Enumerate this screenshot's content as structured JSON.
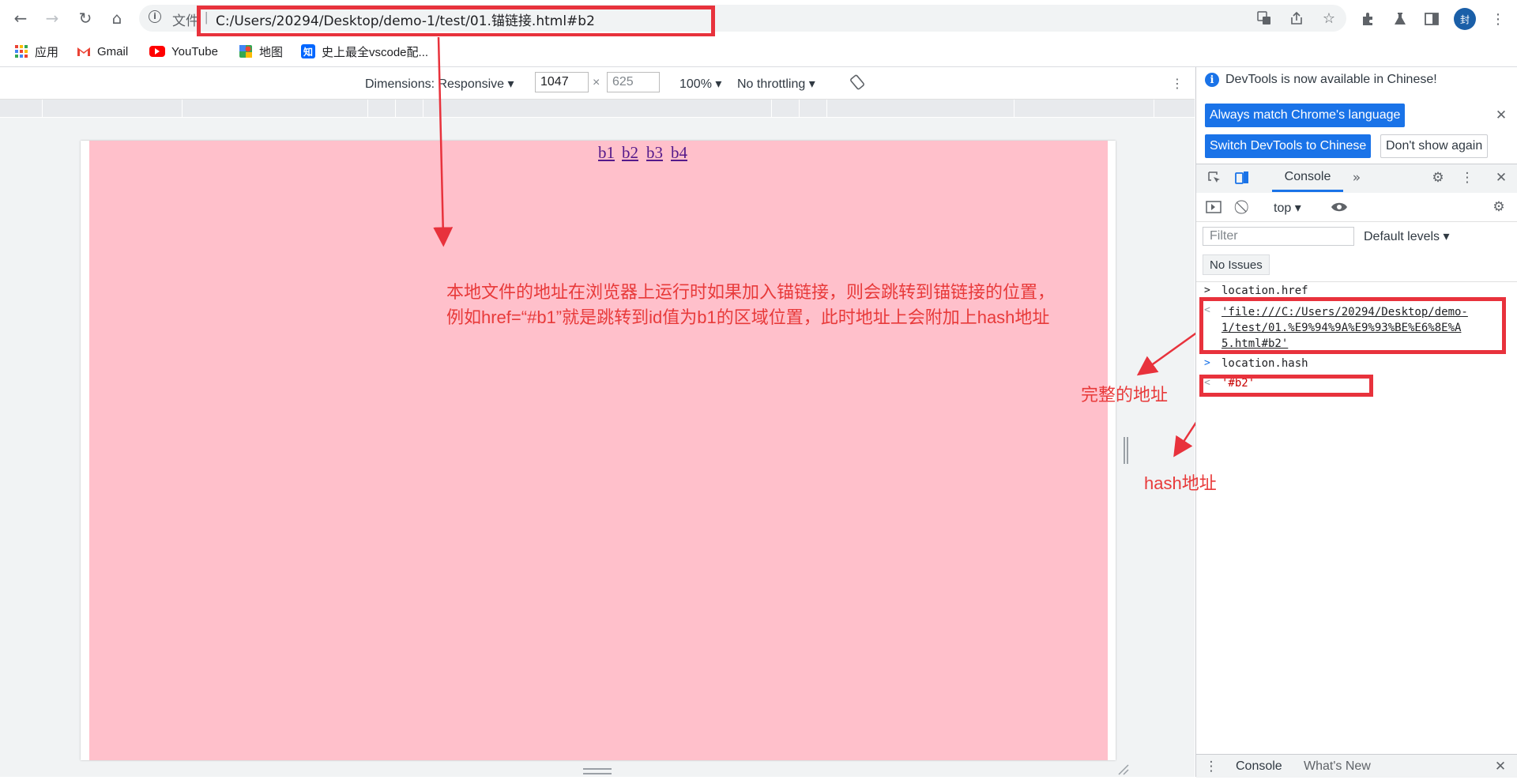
{
  "browser": {
    "nav": {
      "back": "←",
      "forward": "→",
      "reload": "↻",
      "home": "⌂"
    },
    "omnibox": {
      "security_label": "文件",
      "separator": "|",
      "url": "C:/Users/20294/Desktop/demo-1/test/01.锚链接.html#b2"
    },
    "avatar_label": "封"
  },
  "bookmarks": [
    {
      "label": "应用",
      "icon": "apps-grid-icon"
    },
    {
      "label": "Gmail",
      "icon": "gmail-icon"
    },
    {
      "label": "YouTube",
      "icon": "youtube-icon"
    },
    {
      "label": "地图",
      "icon": "maps-icon"
    },
    {
      "label": "史上最全vscode配...",
      "icon": "zhihu-icon",
      "icon_text": "知"
    }
  ],
  "device_toolbar": {
    "dimensions_label": "Dimensions: Responsive",
    "width_value": "1047",
    "times": "×",
    "height_value": "625",
    "zoom": "100%",
    "throttling": "No throttling"
  },
  "page": {
    "background_color": "#ffc0cb",
    "links": [
      "b1",
      "b2",
      "b3",
      "b4"
    ]
  },
  "annotation": {
    "line1": "本地文件的地址在浏览器上运行时如果加入锚链接，则会跳转到锚链接的位置，",
    "line2": "例如href=“#b1”就是跳转到id值为b1的区域位置，此时地址上会附加上hash地址",
    "full_address_label": "完整的地址",
    "hash_label": "hash地址",
    "color": "#e83a3a"
  },
  "devtools": {
    "notice": "DevTools is now available in Chinese!",
    "btn_match_language": "Always match Chrome's language",
    "btn_switch_chinese": "Switch DevTools to Chinese",
    "btn_dont_show": "Don't show again",
    "tab_console": "Console",
    "context": "top",
    "filter_placeholder": "Filter",
    "levels": "Default levels",
    "issues": "No Issues",
    "console": {
      "cmd1": "location.href",
      "result1_line1": "'file:///C:/Users/20294/Desktop/demo-",
      "result1_line2": "1/test/01.%E9%94%9A%E9%93%BE%E6%8E%A",
      "result1_line3": "5.html#b2'",
      "cmd2": "location.hash",
      "result2": "'#b2'"
    },
    "drawer_tab_console": "Console",
    "drawer_tab_whats_new": "What's New",
    "accent_color": "#1a73e8"
  }
}
